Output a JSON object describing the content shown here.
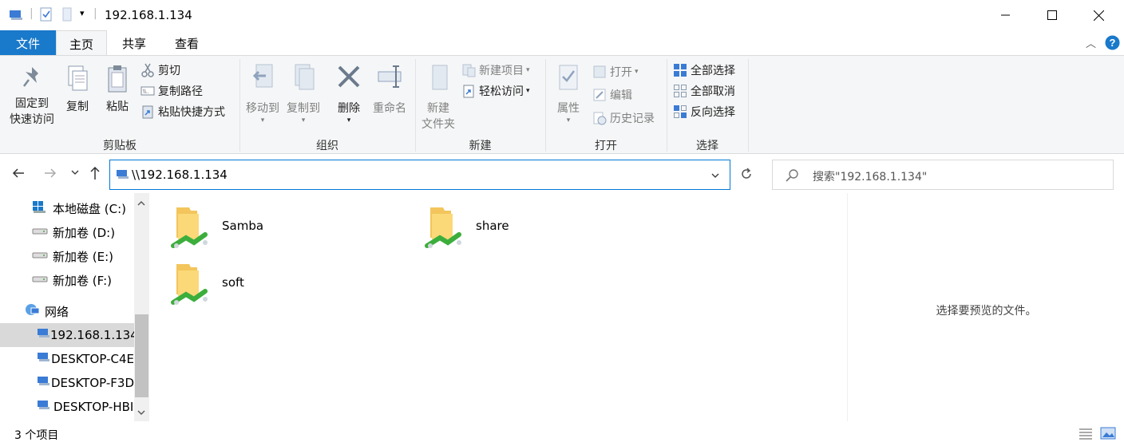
{
  "window": {
    "title": "192.168.1.134"
  },
  "tabs": [
    {
      "label": "文件"
    },
    {
      "label": "主页"
    },
    {
      "label": "共享"
    },
    {
      "label": "查看"
    }
  ],
  "ribbon": {
    "clipboard": {
      "pin_line1": "固定到",
      "pin_line2": "快速访问",
      "copy": "复制",
      "paste": "粘贴",
      "cut": "剪切",
      "copy_path": "复制路径",
      "paste_shortcut": "粘贴快捷方式",
      "label": "剪贴板"
    },
    "organize": {
      "move_to": "移动到",
      "copy_to": "复制到",
      "delete": "删除",
      "rename": "重命名",
      "label": "组织"
    },
    "new": {
      "new_folder_line1": "新建",
      "new_folder_line2": "文件夹",
      "new_item": "新建项目",
      "easy_access": "轻松访问",
      "label": "新建"
    },
    "open": {
      "properties": "属性",
      "open": "打开",
      "edit": "编辑",
      "history": "历史记录",
      "label": "打开"
    },
    "select": {
      "select_all": "全部选择",
      "select_none": "全部取消",
      "invert": "反向选择",
      "label": "选择"
    }
  },
  "address": {
    "path": "\\\\192.168.1.134",
    "search_placeholder": "搜索\"192.168.1.134\""
  },
  "nav": {
    "items": [
      {
        "label": "本地磁盘 (C:)",
        "icon": "windows-drive-icon"
      },
      {
        "label": "新加卷 (D:)",
        "icon": "drive-icon"
      },
      {
        "label": "新加卷 (E:)",
        "icon": "drive-icon"
      },
      {
        "label": "新加卷 (F:)",
        "icon": "drive-icon"
      },
      {
        "label": "网络",
        "icon": "network-icon"
      },
      {
        "label": "192.168.1.134",
        "icon": "computer-icon"
      },
      {
        "label": "DESKTOP-C4E",
        "icon": "computer-icon"
      },
      {
        "label": "DESKTOP-F3D",
        "icon": "computer-icon"
      },
      {
        "label": "DESKTOP-HBI",
        "icon": "computer-icon"
      }
    ]
  },
  "folders": [
    {
      "name": "Samba"
    },
    {
      "name": "share"
    },
    {
      "name": "soft"
    }
  ],
  "preview": {
    "message": "选择要预览的文件。"
  },
  "status": {
    "count": "3 个项目"
  },
  "colors": {
    "accent": "#1979ca",
    "selected": "#d9d9d9"
  }
}
